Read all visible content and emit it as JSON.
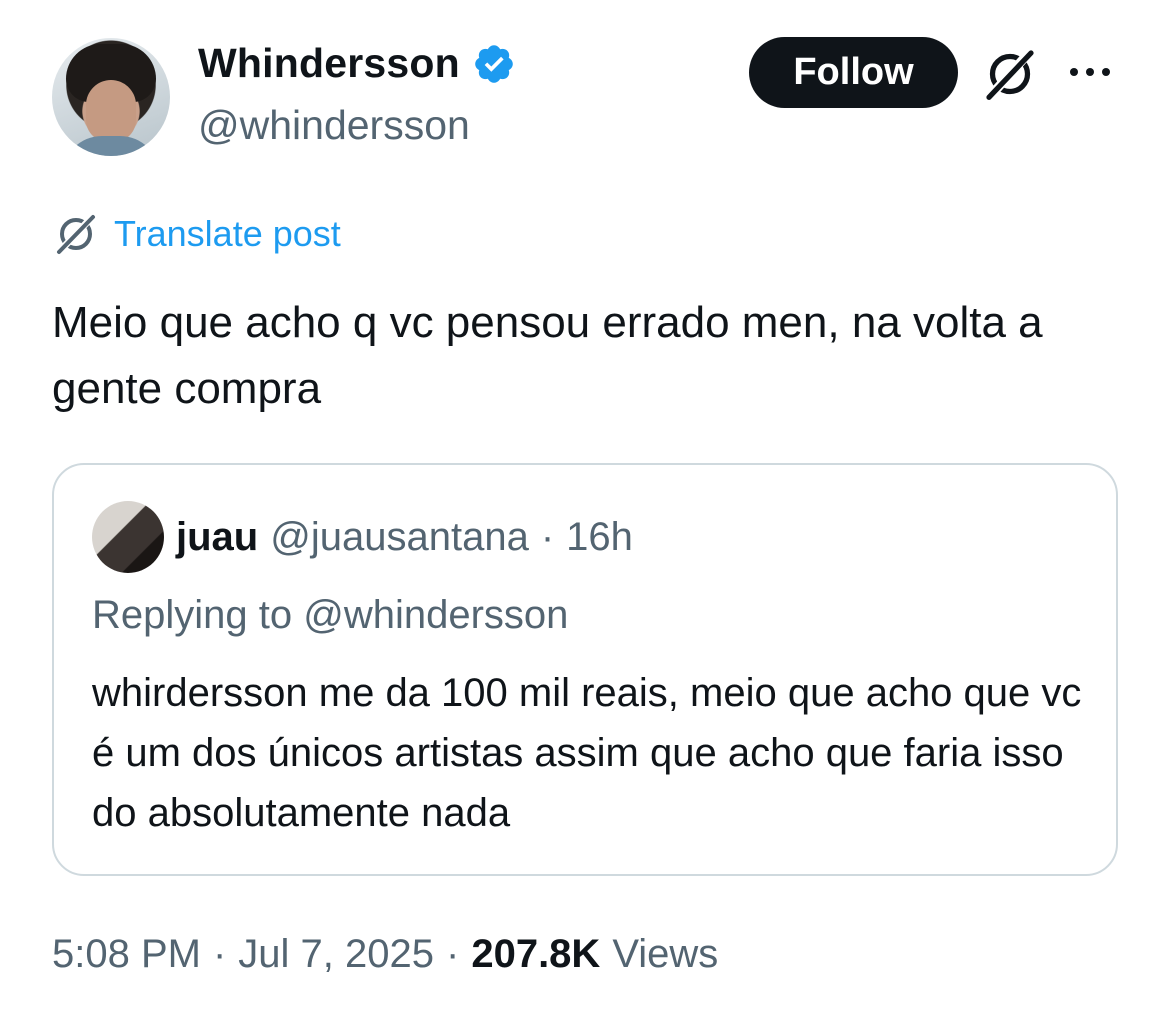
{
  "author": {
    "display_name": "Whindersson",
    "handle": "@whindersson",
    "verified": true
  },
  "actions": {
    "follow_label": "Follow"
  },
  "translate": {
    "label": "Translate post"
  },
  "post": {
    "text": "Meio que acho q vc pensou errado men, na volta a gente compra"
  },
  "quote": {
    "display_name": "juau",
    "handle": "@juausantana",
    "separator": "·",
    "time": "16h",
    "replying_to": "Replying to @whindersson",
    "text": "whirdersson me da 100 mil reais, meio que acho que vc é um dos únicos artistas assim que acho que faria isso do absolutamente nada"
  },
  "meta": {
    "time": "5:08 PM",
    "separator": "·",
    "date": "Jul 7, 2025",
    "views_count": "207.8K",
    "views_label": "Views"
  },
  "colors": {
    "text": "#0f1419",
    "secondary": "#536471",
    "link": "#1d9bf0",
    "verified": "#1d9bf0",
    "border": "#cfd9de"
  },
  "icons": [
    "verified-badge-icon",
    "grok-icon",
    "more-icon",
    "translate-icon"
  ]
}
